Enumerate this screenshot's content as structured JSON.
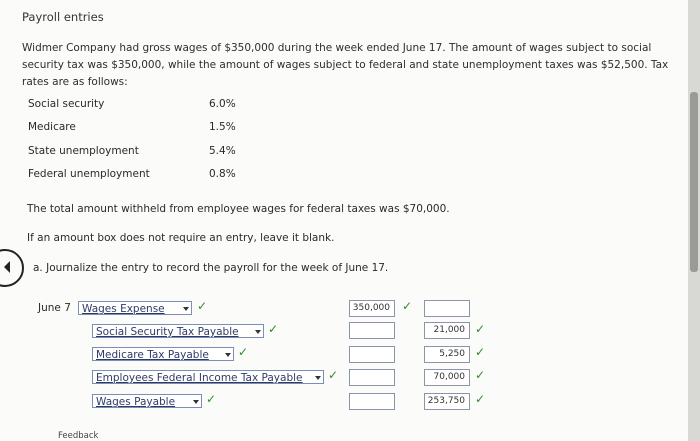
{
  "title": "Payroll entries",
  "description": "Widmer Company had gross wages of $350,000 during the week ended June 17. The amount of wages subject to social security tax was $350,000, while the amount of wages subject to federal and state unemployment taxes was $52,500. Tax rates are as follows:",
  "rates": [
    {
      "name": "Social security",
      "value": "6.0%"
    },
    {
      "name": "Medicare",
      "value": "1.5%"
    },
    {
      "name": "State unemployment",
      "value": "5.4%"
    },
    {
      "name": "Federal unemployment",
      "value": "0.8%"
    }
  ],
  "withheld_text": "The total amount withheld from employee wages for federal taxes was $70,000.",
  "instruction": "If an amount box does not require an entry, leave it blank.",
  "part_a": "a.  Journalize the entry to record the payroll for the week of June 17.",
  "journal": {
    "date": "June 7",
    "check_mark": "✓",
    "lines": [
      {
        "account": "Wages Expense",
        "debit": "350,000",
        "credit": ""
      },
      {
        "account": "Social Security Tax Payable",
        "debit": "",
        "credit": "21,000"
      },
      {
        "account": "Medicare Tax Payable",
        "debit": "",
        "credit": "5,250"
      },
      {
        "account": "Employees Federal Income Tax Payable",
        "debit": "",
        "credit": "70,000"
      },
      {
        "account": "Wages Payable",
        "debit": "",
        "credit": "253,750"
      }
    ]
  },
  "feedback_label": "Feedback",
  "colors": {
    "check": "#2f8a2f",
    "account_text": "#2f3b66"
  }
}
